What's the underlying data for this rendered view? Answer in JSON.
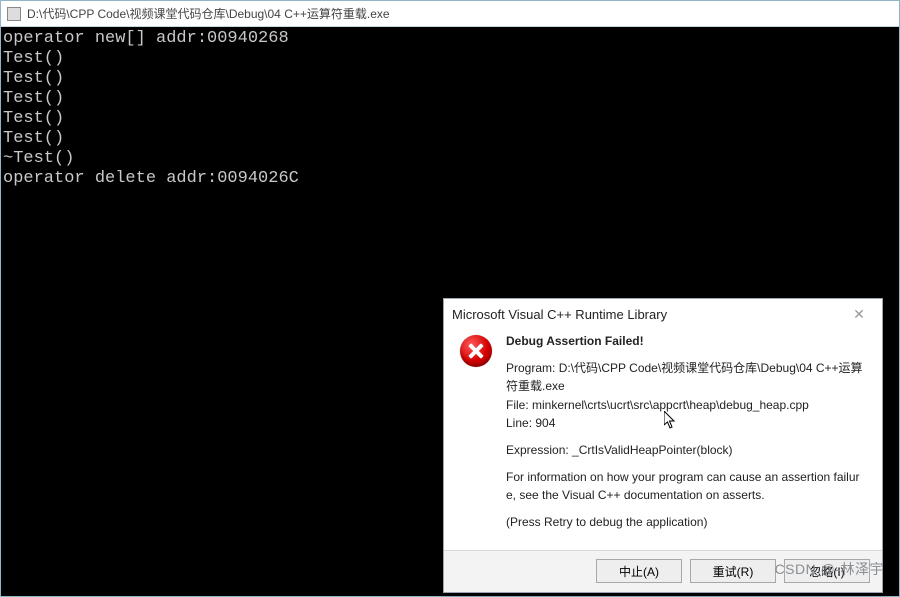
{
  "window": {
    "title": "D:\\代码\\CPP Code\\视频课堂代码仓库\\Debug\\04 C++运算符重载.exe"
  },
  "console": {
    "lines": [
      "operator new[] addr:00940268",
      "Test()",
      "Test()",
      "Test()",
      "Test()",
      "Test()",
      "~Test()",
      "operator delete addr:0094026C"
    ]
  },
  "dialog": {
    "title": "Microsoft Visual C++ Runtime Library",
    "heading": "Debug Assertion Failed!",
    "program_label": "Program: ",
    "program_value": "D:\\代码\\CPP Code\\视频课堂代码仓库\\Debug\\04 C++运算符重载.exe",
    "file_label": "File: ",
    "file_value": "minkernel\\crts\\ucrt\\src\\appcrt\\heap\\debug_heap.cpp",
    "line_label": "Line: ",
    "line_value": "904",
    "expression_label": "Expression: ",
    "expression_value": "_CrtIsValidHeapPointer(block)",
    "info_text": "For information on how your program can cause an assertion failure, see the Visual C++ documentation on asserts.",
    "retry_text": "(Press Retry to debug the application)",
    "buttons": {
      "abort": "中止(A)",
      "retry": "重试(R)",
      "ignore": "忽略(I)"
    }
  },
  "watermark": "CSDN @-林泽宇"
}
